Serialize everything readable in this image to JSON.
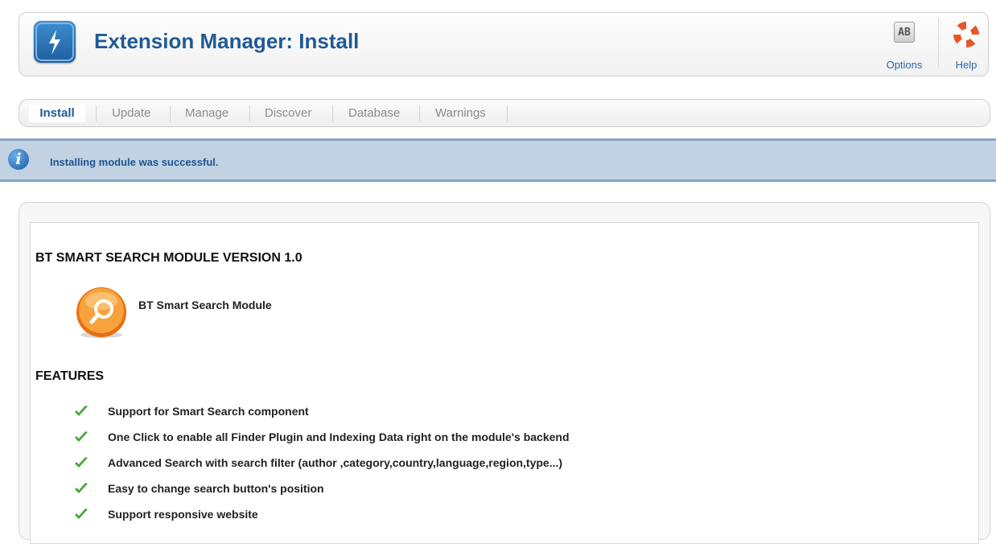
{
  "header": {
    "title": "Extension Manager: Install",
    "app_icon": "lightning-icon",
    "toolbar": [
      {
        "label": "Options",
        "icon": "options-icon"
      },
      {
        "label": "Help",
        "icon": "lifebuoy-icon"
      }
    ],
    "options_glyph": "AB"
  },
  "tabs": [
    {
      "label": "Install",
      "active": true
    },
    {
      "label": "Update",
      "active": false
    },
    {
      "label": "Manage",
      "active": false
    },
    {
      "label": "Discover",
      "active": false
    },
    {
      "label": "Database",
      "active": false
    },
    {
      "label": "Warnings",
      "active": false
    }
  ],
  "message": {
    "text": "Installing module was successful.",
    "icon": "info-icon"
  },
  "content": {
    "heading": "BT SMART SEARCH MODULE VERSION 1.0",
    "module_name": "BT Smart Search Module",
    "features_heading": "FEATURES",
    "features": [
      "Support for Smart Search component",
      "One Click to enable all Finder Plugin and Indexing Data right on the module's backend",
      "Advanced Search with search filter (author ,category,country,language,region,type...)",
      "Easy to change search button's position",
      "Support responsive website"
    ]
  },
  "colors": {
    "title_blue": "#1f5a95",
    "message_bg": "#c3d2e3",
    "check_green": "#4aa83a"
  }
}
